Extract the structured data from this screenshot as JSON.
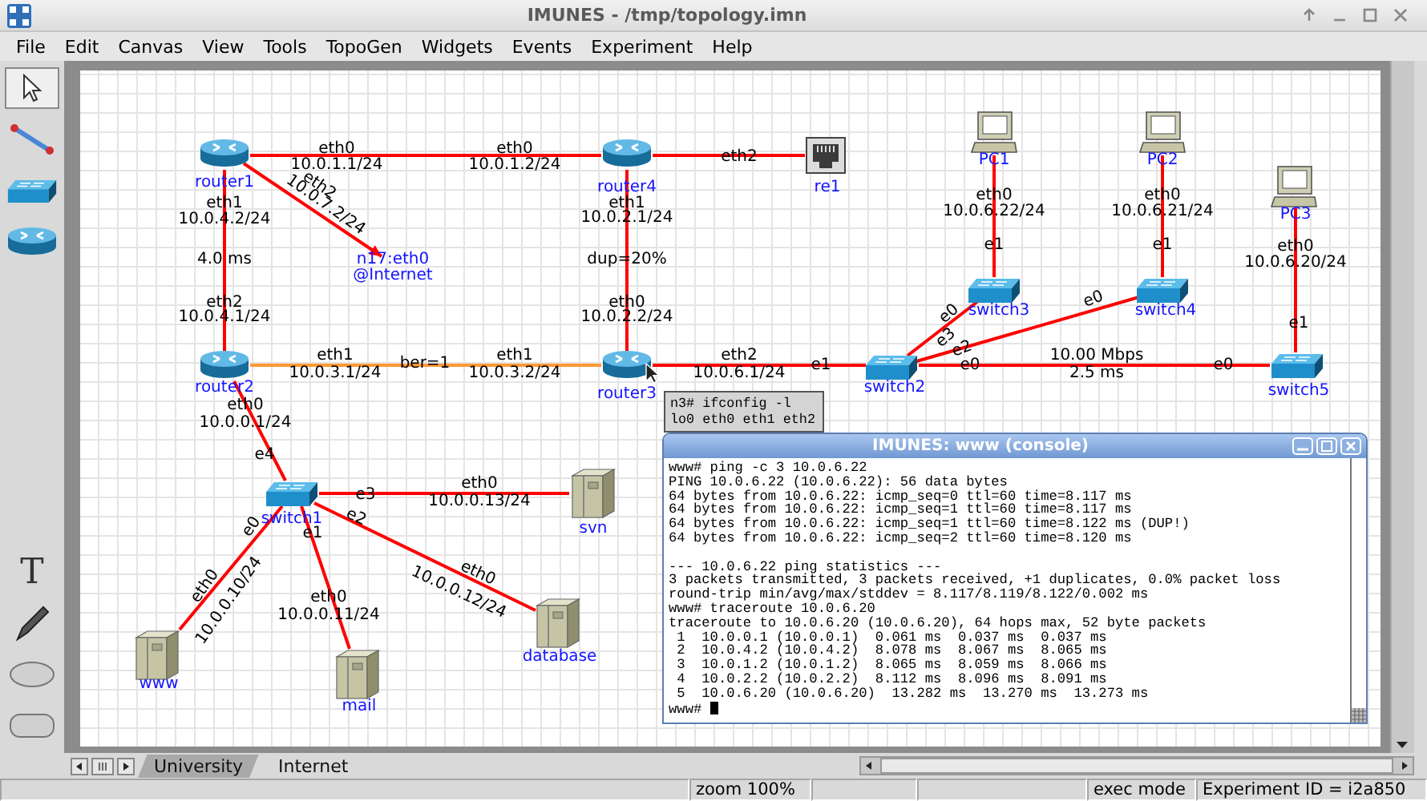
{
  "window": {
    "title": "IMUNES - /tmp/topology.imn"
  },
  "menu": [
    "File",
    "Edit",
    "Canvas",
    "View",
    "Tools",
    "TopoGen",
    "Widgets",
    "Events",
    "Experiment",
    "Help"
  ],
  "tools": [
    {
      "kind": "select",
      "selected": true
    },
    {
      "kind": "link",
      "selected": false
    },
    {
      "kind": "switch",
      "selected": false
    },
    {
      "kind": "router",
      "selected": false
    },
    {
      "kind": "text",
      "glyph": "T",
      "selected": false
    },
    {
      "kind": "freeform",
      "selected": false
    },
    {
      "kind": "oval",
      "selected": false
    },
    {
      "kind": "rectangle",
      "selected": false
    }
  ],
  "nodes": [
    {
      "name": "router1",
      "kind": "router"
    },
    {
      "name": "router4",
      "kind": "router"
    },
    {
      "name": "re1",
      "kind": "rj45"
    },
    {
      "name": "router2",
      "kind": "router"
    },
    {
      "name": "router3",
      "kind": "router"
    },
    {
      "name": "switch2",
      "kind": "switch"
    },
    {
      "name": "switch5",
      "kind": "switch"
    },
    {
      "name": "switch3",
      "kind": "switch"
    },
    {
      "name": "switch4",
      "kind": "switch"
    },
    {
      "name": "PC1",
      "kind": "pc"
    },
    {
      "name": "PC2",
      "kind": "pc"
    },
    {
      "name": "PC3",
      "kind": "pc"
    },
    {
      "name": "switch1",
      "kind": "switch"
    },
    {
      "name": "svn",
      "kind": "host"
    },
    {
      "name": "database",
      "kind": "host"
    },
    {
      "name": "mail",
      "kind": "host"
    },
    {
      "name": "www",
      "kind": "host"
    },
    {
      "name": "n17:eth0",
      "network": "@Internet",
      "kind": "peer"
    }
  ],
  "links": [
    {
      "kind": "wire",
      "labels": [
        "eth0",
        "10.0.1.1/24",
        "eth0",
        "10.0.1.2/24"
      ]
    },
    {
      "kind": "wire",
      "labels": [
        "eth2"
      ]
    },
    {
      "kind": "remote",
      "labels": [
        "eth2",
        "10.0.7.2/24"
      ]
    },
    {
      "kind": "wire",
      "labels": [
        "eth0",
        "10.0.6.22/24",
        "e1"
      ]
    },
    {
      "kind": "wire",
      "labels": [
        "eth0",
        "10.0.6.21/24",
        "e1"
      ]
    },
    {
      "kind": "wire",
      "labels": [
        "eth1",
        "10.0.4.2/24",
        "4.0 ms",
        "eth2",
        "10.0.4.1/24"
      ]
    },
    {
      "kind": "wire",
      "labels": [
        "eth1",
        "10.0.2.1/24",
        "dup=20%",
        "eth0",
        "10.0.2.2/24"
      ]
    },
    {
      "kind": "wire",
      "labels": [
        "eth0",
        "10.0.6.20/24",
        "e1"
      ]
    },
    {
      "kind": "lossy",
      "labels": [
        "eth1",
        "10.0.3.1/24",
        "ber=1",
        "eth1",
        "10.0.3.2/24"
      ]
    },
    {
      "kind": "wire",
      "labels": [
        "eth2",
        "10.0.6.1/24",
        "e1"
      ]
    },
    {
      "kind": "wire",
      "labels": [
        "e3",
        "e0"
      ]
    },
    {
      "kind": "wire",
      "labels": [
        "e2",
        "e0"
      ]
    },
    {
      "kind": "wire",
      "labels": [
        "e0",
        "10.00 Mbps",
        "2.5 ms",
        "e0"
      ]
    },
    {
      "kind": "wire",
      "labels": [
        "eth0",
        "10.0.0.1/24",
        "e4"
      ]
    },
    {
      "kind": "wire",
      "labels": [
        "e3",
        "eth0",
        "10.0.0.13/24"
      ]
    },
    {
      "kind": "wire",
      "labels": [
        "e2",
        "eth0",
        "10.0.0.12/24"
      ]
    },
    {
      "kind": "wire",
      "labels": [
        "e1",
        "eth0",
        "10.0.0.11/24"
      ]
    },
    {
      "kind": "wire",
      "labels": [
        "e0",
        "eth0",
        "10.0.0.10/24"
      ]
    }
  ],
  "tooltip": [
    "n3# ifconfig -l",
    "lo0 eth0 eth1 eth2"
  ],
  "console": {
    "title": "IMUNES: www (console)",
    "blocks": [
      [
        "www# ping -c 3 10.0.6.22",
        "PING 10.0.6.22 (10.0.6.22): 56 data bytes",
        "64 bytes from 10.0.6.22: icmp_seq=0 ttl=60 time=8.117 ms",
        "64 bytes from 10.0.6.22: icmp_seq=1 ttl=60 time=8.117 ms",
        "64 bytes from 10.0.6.22: icmp_seq=1 ttl=60 time=8.122 ms (DUP!)",
        "64 bytes from 10.0.6.22: icmp_seq=2 ttl=60 time=8.120 ms"
      ],
      [
        "--- 10.0.6.22 ping statistics ---",
        "3 packets transmitted, 3 packets received, +1 duplicates, 0.0% packet loss",
        "round-trip min/avg/max/stddev = 8.117/8.119/8.122/0.002 ms",
        "www# traceroute 10.0.6.20",
        "traceroute to 10.0.6.20 (10.0.6.20), 64 hops max, 52 byte packets",
        " 1  10.0.0.1 (10.0.0.1)  0.061 ms  0.037 ms  0.037 ms",
        " 2  10.0.4.2 (10.0.4.2)  8.078 ms  8.067 ms  8.065 ms",
        " 3  10.0.1.2 (10.0.1.2)  8.065 ms  8.059 ms  8.066 ms",
        " 4  10.0.2.2 (10.0.2.2)  8.112 ms  8.096 ms  8.091 ms",
        " 5  10.0.6.20 (10.0.6.20)  13.282 ms  13.270 ms  13.273 ms"
      ]
    ],
    "prompt": "www#"
  },
  "tabs": [
    {
      "label": "University",
      "selected": true
    },
    {
      "label": "Internet",
      "selected": false
    }
  ],
  "status_bar": [
    "zoom 100%",
    "exec mode",
    "Experiment ID = i2a850"
  ]
}
